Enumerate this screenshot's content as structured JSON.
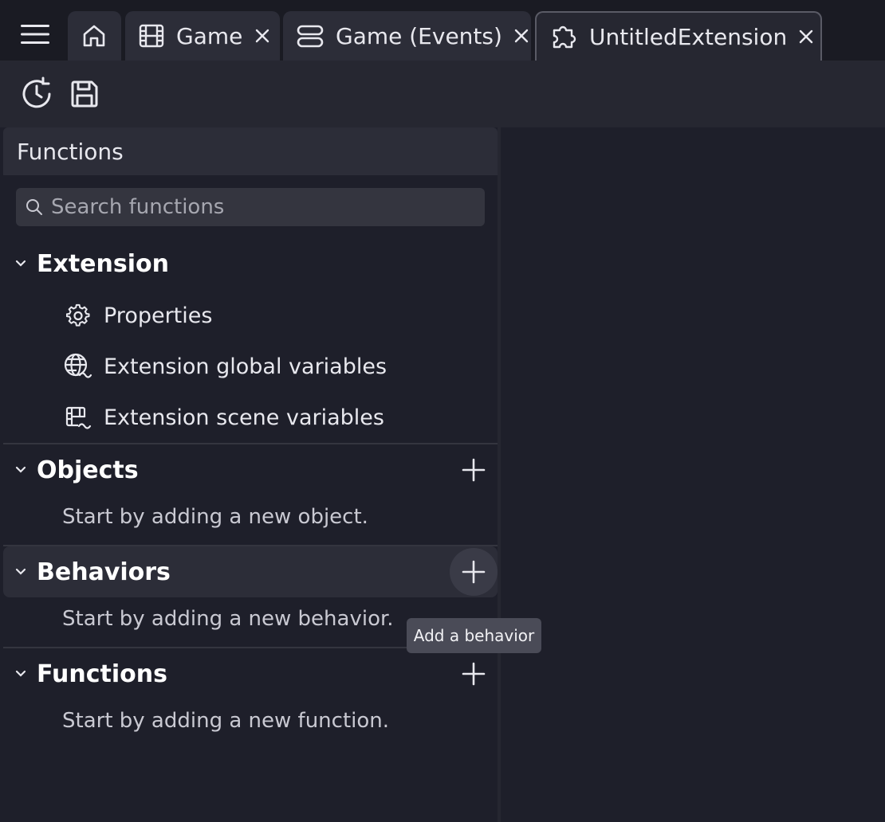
{
  "tabs": [
    {
      "label": "",
      "icon": "home-icon"
    },
    {
      "label": "Game",
      "icon": "film-icon",
      "close": "close-icon"
    },
    {
      "label": "Game (Events)",
      "icon": "events-icon",
      "close": "close-icon"
    },
    {
      "label": "UntitledExtension",
      "icon": "puzzle-icon",
      "close": "close-icon"
    }
  ],
  "toolbar": {
    "history_icon": "history-icon",
    "save_icon": "save-icon"
  },
  "panel": {
    "title": "Functions",
    "search_placeholder": "Search functions"
  },
  "sections": {
    "extension": {
      "title": "Extension",
      "items": [
        {
          "label": "Properties",
          "icon": "gear-icon"
        },
        {
          "label": "Extension global variables",
          "icon": "globe-icon"
        },
        {
          "label": "Extension scene variables",
          "icon": "scene-variables-icon"
        }
      ]
    },
    "objects": {
      "title": "Objects",
      "empty": "Start by adding a new object."
    },
    "behaviors": {
      "title": "Behaviors",
      "empty": "Start by adding a new behavior."
    },
    "functions": {
      "title": "Functions",
      "empty": "Start by adding a new function."
    }
  },
  "tooltip": "Add a behavior",
  "colors": {
    "background": "#1e1f2a",
    "panel_header": "#2c2d38",
    "accent_outline": "#5a5b66"
  }
}
